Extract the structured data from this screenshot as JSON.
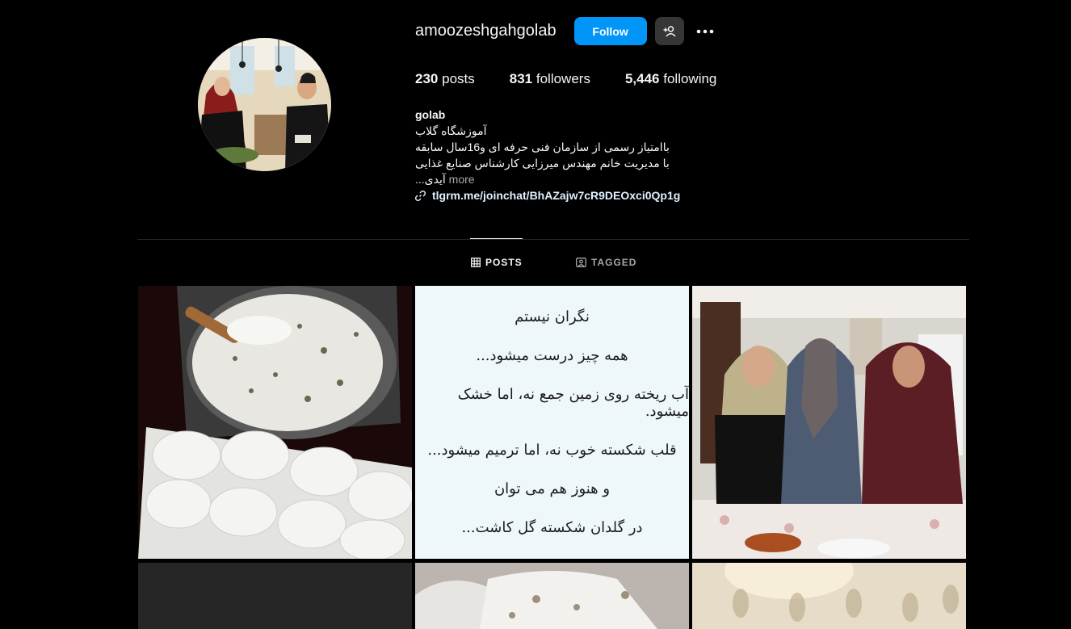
{
  "profile": {
    "username": "amoozeshgahgolab",
    "follow_label": "Follow",
    "stats": {
      "posts_count": "230",
      "posts_label": "posts",
      "followers_count": "831",
      "followers_label": "followers",
      "following_count": "5,446",
      "following_label": "following"
    },
    "bio": {
      "name": "golab",
      "line1": "آموزشگاه گلاب",
      "line2": "باامتیاز رسمی از سازمان فنی حرفه ای و16سال سابقه",
      "line3": "با مدیریت خانم مهندس میرزایی کارشناس صنایع غذایی",
      "line4": "آیدی...",
      "more_label": "more",
      "link": "tlgrm.me/joinchat/BhAZajw7cR9DEOxci0Qp1g"
    }
  },
  "tabs": {
    "posts": "POSTS",
    "tagged": "TAGGED"
  },
  "posts": {
    "quote_lines": [
      "نگران نیستم",
      "همه چیز درست میشود...",
      "آب ریخته روی زمین جمع نه، اما خشک میشود.",
      "قلب شکسته خوب نه، اما ترمیم میشود...",
      "و هنوز هم می توان",
      "در گلدان شکسته گل کاشت..."
    ]
  },
  "colors": {
    "accent": "#0095f6",
    "background": "#000000",
    "secondary_text": "#a8a8a8",
    "divider": "#262626"
  },
  "icons": {
    "suggest": "add-person-icon",
    "more": "more-horizontal-icon",
    "link": "link-icon",
    "posts_tab": "grid-icon",
    "tagged_tab": "tagged-icon"
  }
}
